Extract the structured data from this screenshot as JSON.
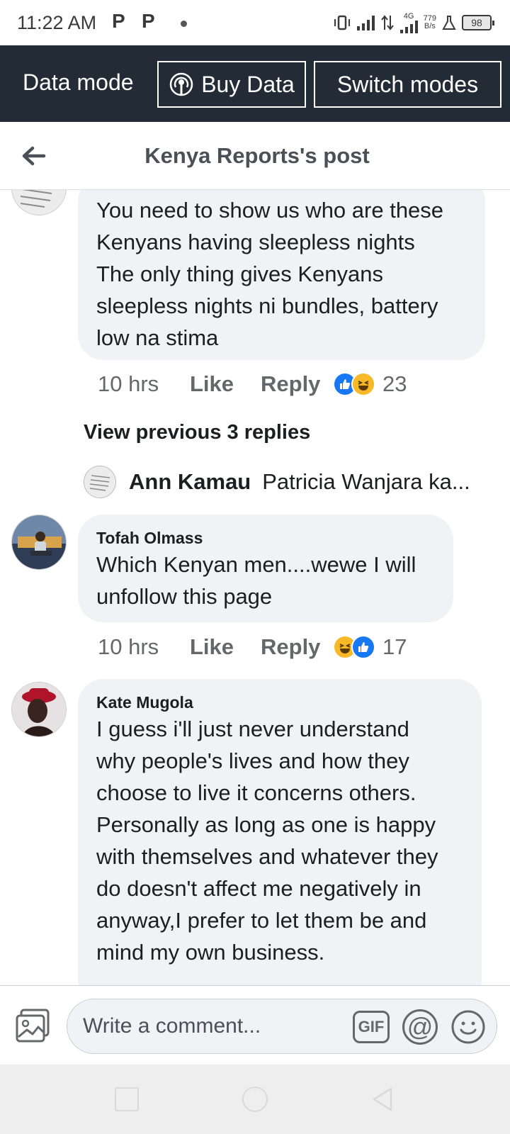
{
  "status_bar": {
    "time": "11:22 AM",
    "notif_icon_1": "P",
    "notif_icon_2": "P",
    "network_type": "4G",
    "speed_value": "779",
    "speed_unit": "B/s",
    "battery": "98"
  },
  "data_bar": {
    "mode_label": "Data mode",
    "buy_label": "Buy Data",
    "switch_label": "Switch modes"
  },
  "header": {
    "title": "Kenya Reports's post"
  },
  "comments": [
    {
      "author": "",
      "text_lines": [
        "You need to show us who are these",
        "Kenyans having sleepless nights",
        "The only thing gives Kenyans",
        "sleepless nights ni bundles, battery",
        "low na stima"
      ],
      "time": "10 hrs",
      "like_label": "Like",
      "reply_label": "Reply",
      "reactions": [
        "like",
        "haha"
      ],
      "reaction_count": "23"
    },
    {
      "author": "Tofah Olmass",
      "text_lines": [
        "Which Kenyan men....wewe I will",
        "unfollow this page"
      ],
      "time": "10 hrs",
      "like_label": "Like",
      "reply_label": "Reply",
      "reactions": [
        "haha",
        "like"
      ],
      "reaction_count": "17"
    },
    {
      "author": "Kate Mugola",
      "text_lines": [
        "I guess i'll just never understand",
        "why people's lives and how they",
        "choose to live it concerns others.",
        "Personally as long as one is happy",
        "with themselves and whatever they",
        "do doesn't affect me negatively in",
        "anyway,I prefer to let them be and",
        "mind my own business."
      ]
    }
  ],
  "replies": {
    "view_previous": "View previous 3 replies",
    "preview_name": "Ann Kamau",
    "preview_text": "Patricia Wanjara ka..."
  },
  "composer": {
    "placeholder": "Write a comment...",
    "gif_label": "GIF",
    "mention_label": "@"
  },
  "colors": {
    "data_bar_bg": "#232b36",
    "bubble_bg": "#f0f2f5",
    "like_blue": "#1877f2",
    "haha_yellow": "#f7b928"
  }
}
